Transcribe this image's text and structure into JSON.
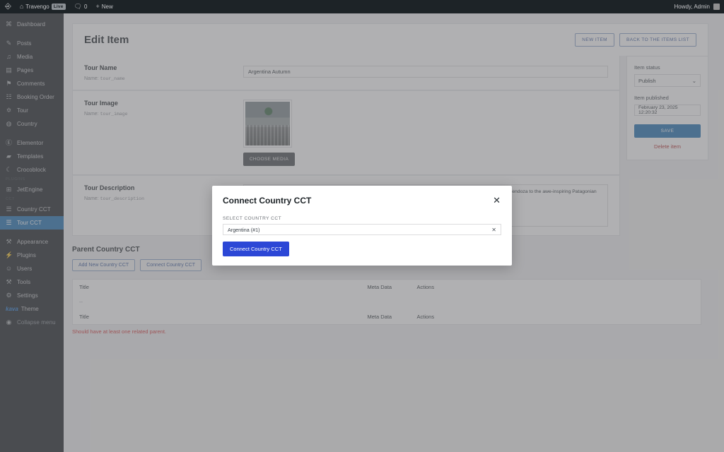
{
  "adminbar": {
    "wp_logo_icon": "wordpress-logo-icon",
    "site_icon": "home-icon",
    "site_name": "Travengo",
    "live_badge": "Live",
    "comments_icon": "comment-bubble-icon",
    "comments_count": "0",
    "new_icon": "plus-icon",
    "new_label": "New",
    "howdy": "Howdy, Admin",
    "avatar": "user-avatar"
  },
  "sidebar": {
    "items": [
      {
        "label": "Dashboard",
        "icon": "dashboard-icon",
        "glyph": "⌘",
        "type": "item"
      },
      {
        "type": "sep"
      },
      {
        "label": "Posts",
        "icon": "pin-icon",
        "glyph": "✎",
        "type": "item"
      },
      {
        "label": "Media",
        "icon": "media-icon",
        "glyph": "♫",
        "type": "item"
      },
      {
        "label": "Pages",
        "icon": "page-icon",
        "glyph": "▤",
        "type": "item"
      },
      {
        "label": "Comments",
        "icon": "comment-icon",
        "glyph": "⚑",
        "type": "item"
      },
      {
        "label": "Booking Order",
        "icon": "cart-icon",
        "glyph": "☷",
        "type": "item"
      },
      {
        "label": "Tour",
        "icon": "person-icon",
        "glyph": "✡",
        "type": "item"
      },
      {
        "label": "Country",
        "icon": "globe-icon",
        "glyph": "◍",
        "type": "item"
      },
      {
        "type": "sep"
      },
      {
        "label": "Elementor",
        "icon": "elementor-icon",
        "glyph": "Ⓔ",
        "type": "item"
      },
      {
        "label": "Templates",
        "icon": "folder-icon",
        "glyph": "▰",
        "type": "item"
      },
      {
        "label": "Crocoblock",
        "icon": "moon-icon",
        "glyph": "☾",
        "type": "item"
      },
      {
        "type": "group",
        "label": "PLUGINS"
      },
      {
        "label": "JetEngine",
        "icon": "jetengine-icon",
        "glyph": "⊞",
        "type": "item"
      },
      {
        "type": "group",
        "label": "CCT"
      },
      {
        "label": "Country CCT",
        "icon": "list-icon",
        "glyph": "☰",
        "type": "item"
      },
      {
        "label": "Tour CCT",
        "icon": "list-icon",
        "glyph": "☰",
        "type": "item",
        "active": true
      },
      {
        "type": "sep"
      },
      {
        "label": "Appearance",
        "icon": "brush-icon",
        "glyph": "⚒",
        "type": "item"
      },
      {
        "label": "Plugins",
        "icon": "plug-icon",
        "glyph": "⚡",
        "type": "item"
      },
      {
        "label": "Users",
        "icon": "users-icon",
        "glyph": "☺",
        "type": "item"
      },
      {
        "label": "Tools",
        "icon": "wrench-icon",
        "glyph": "⚒",
        "type": "item"
      },
      {
        "label": "Settings",
        "icon": "settings-icon",
        "glyph": "⚙",
        "type": "item"
      }
    ],
    "theme": {
      "logo_text": "kava",
      "label": "Theme"
    },
    "collapse": {
      "icon": "collapse-arrow-icon",
      "label": "Collapse menu"
    }
  },
  "editor": {
    "title": "Edit Item",
    "new_item_button": "NEW ITEM",
    "back_to_list_button": "BACK TO THE ITEMS LIST",
    "fields": [
      {
        "title": "Tour Name",
        "name_prefix": "Name: ",
        "name_slug": "tour_name",
        "kind": "text",
        "value": "Argentina Autumn"
      },
      {
        "title": "Tour Image",
        "name_prefix": "Name: ",
        "name_slug": "tour_image",
        "kind": "media",
        "choose_media_button": "CHOOSE MEDIA",
        "image_alt": "buenos-aires-cityscape-thumbnail"
      },
      {
        "title": "Tour Description",
        "name_prefix": "Name: ",
        "name_slug": "tour_description",
        "kind": "textarea",
        "value": "The \"Argentina Autumn\" tour offers a vibrant exploration of Argentina's stunning landscapes, from the colorful vineyards of Mendoza to the awe-inspiring Patagonian"
      }
    ]
  },
  "side_panel": {
    "status_label": "Item status",
    "status_value": "Publish",
    "status_chevron": "chevron-down-icon",
    "published_label": "Item published",
    "published_value": "February 23, 2025 12:20:32",
    "save_button": "SAVE",
    "delete_link": "Delete item"
  },
  "parent_section": {
    "title": "Parent Country CCT",
    "add_new_button": "Add New Country CCT",
    "connect_button": "Connect Country CCT",
    "columns": [
      "Title",
      "Meta Data",
      "Actions"
    ],
    "rows": [
      [
        "--",
        "",
        ""
      ]
    ],
    "footer_columns": [
      "Title",
      "Meta Data",
      "Actions"
    ],
    "error_note": "Should have at least one related parent."
  },
  "modal": {
    "title": "Connect Country CCT",
    "close_icon": "close-x-icon",
    "field_label": "SELECT COUNTRY CCT",
    "selected_value": "Argentina (#1)",
    "clear_icon": "clear-x-icon",
    "submit_button": "Connect Country CCT"
  },
  "colors": {
    "admin_dark": "#1d2327",
    "accent_blue": "#2271b1",
    "modal_button_blue": "#2c47d6",
    "danger_red": "#d63638",
    "delete_red": "#b32d2e"
  }
}
